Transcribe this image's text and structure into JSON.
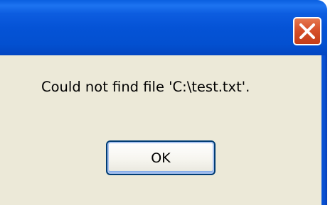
{
  "dialog": {
    "message": "Could not find file 'C:\\test.txt'.",
    "ok_label": "OK",
    "close_icon": "close-x-icon",
    "colors": {
      "title_bar": "#0553d6",
      "close_button": "#d6502a",
      "body_background": "#ece9d8",
      "button_border": "#003c74"
    }
  }
}
